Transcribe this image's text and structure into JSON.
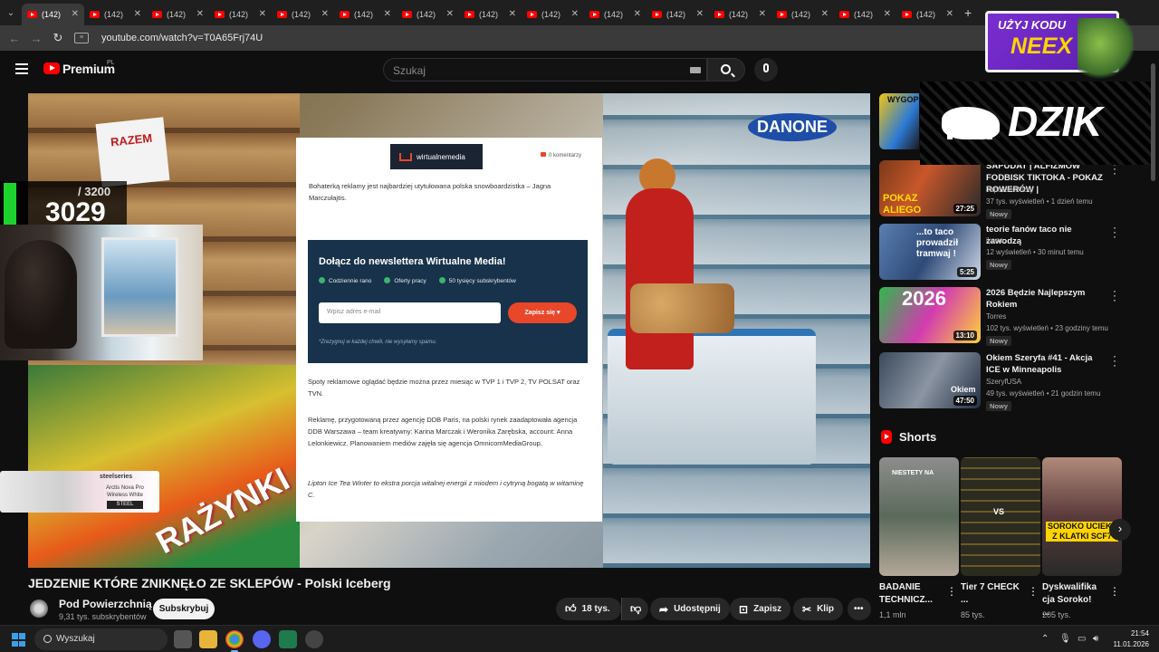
{
  "browser": {
    "tabs": [
      {
        "label": "(142)",
        "active": true
      },
      {
        "label": "(142)",
        "active": false
      },
      {
        "label": "(142)",
        "active": false
      },
      {
        "label": "(142)",
        "active": false
      },
      {
        "label": "(142)",
        "active": false
      },
      {
        "label": "(142)",
        "active": false
      },
      {
        "label": "(142)",
        "active": false
      },
      {
        "label": "(142)",
        "active": false
      },
      {
        "label": "(142)",
        "active": false
      },
      {
        "label": "(142)",
        "active": false
      },
      {
        "label": "(142)",
        "active": false
      },
      {
        "label": "(142)",
        "active": false
      },
      {
        "label": "(142)",
        "active": false
      },
      {
        "label": "(142)",
        "active": false
      },
      {
        "label": "(142)",
        "active": false
      }
    ],
    "url": "youtube.com/watch?v=T0A65Frj74U"
  },
  "youtube": {
    "logo_text": "Premium",
    "logo_region": "PL",
    "search_placeholder": "Szukaj"
  },
  "video": {
    "title": "JEDZENIE KTÓRE ZNIKNĘŁO ZE SKLEPÓW - Polski Iceberg",
    "channel": "Pod Powierzchnią",
    "subscribers": "9,31 tys. subskrybentów",
    "subscribe_label": "Subskrybuj",
    "likes": "18 tys.",
    "share_label": "Udostępnij",
    "save_label": "Zapisz",
    "clip_label": "Klip",
    "scene": {
      "sign_text": "RAZEM",
      "brand_sign": "DANONE",
      "bag_text": "RAŻYNKI"
    }
  },
  "article": {
    "logo": "wirtualnemedia",
    "comments": "0 komentarzy",
    "lead": "Bohaterką reklamy jest najbardziej utytułowana polska snowboardzistka – Jagna Marczułajtis.",
    "newsletter": {
      "title": "Dołącz do newslettera Wirtualne Media!",
      "features": [
        "Codziennie rano",
        "Oferty pracy",
        "50 tysięcy subskrybentów"
      ],
      "email_placeholder": "Wpisz adres e-mail",
      "button": "Zapisz się",
      "note": "*Zrezygnuj w każdej chwili, nie wysyłamy spamu."
    },
    "p1": "Spoty reklamowe oglądać będzie można przez miesiąc w TVP 1 i TVP 2, TV POLSAT oraz TVN.",
    "p2": "Reklamę, przygotowaną przez agencję DDB Paris, na polski rynek zaadaptowała agencja DDB Warszawa – team kreatywny: Karina Marczak i Weronika Zarębska, account: Anna Lelonkiewicz. Planowaniem mediów zajęła się agencja OmnicomMediaGroup.",
    "p3": "Lipton Ice Tea Winter to ekstra porcja witalnej energii z miodem i cytryną bogatą w witaminę C."
  },
  "overlay": {
    "score_total": "/ 3200",
    "score_value": "3029",
    "steelseries_brand": "steelseries",
    "steelseries_product": "Arctis Nova Pro Wireless White",
    "steelseries_btn": "STEEL",
    "neex_line1": "UŻYJ KODU",
    "neex_line2": "NEEX",
    "dzik": "DZIK"
  },
  "sidebar": {
    "recs": [
      {
        "title": "SAPUDAT | ALFIZMOW FODBISK TIKTOKA - POKAZ ROWERÓW |",
        "channel": "Japczan Shoty",
        "meta": "37 tys. wyświetleń • 1 dzień temu",
        "badge": "Nowy",
        "duration": "27:25"
      },
      {
        "title": "teorie fanów taco nie zawodzą",
        "channel": "ikano.",
        "meta": "12 wyświetleń • 30 minut temu",
        "badge": "Nowy",
        "duration": "5:25"
      },
      {
        "title": "2026 Będzie Najlepszym Rokiem",
        "channel": "Torres",
        "meta": "102 tys. wyświetleń • 23 godziny temu",
        "badge": "Nowy",
        "duration": "13:10"
      },
      {
        "title": "Okiem Szeryfa #41 - Akcja ICE w Minneapolis",
        "channel": "SzeryfUSA",
        "meta": "49 tys. wyświetleń • 21 godzin temu",
        "badge": "Nowy",
        "duration": "47:50"
      }
    ],
    "shorts_title": "Shorts",
    "shorts": [
      {
        "title": "BADANIE TECHNICZ...",
        "views": "1,1 mln"
      },
      {
        "title": "Tier 7 CHECK ...",
        "views": "85 tys."
      },
      {
        "title": "Dyskwalifika cja Soroko! ...",
        "views": "205 tys."
      }
    ],
    "short_thumb_texts": [
      "NIESTETY NA",
      "VS",
      "SOROKO UCIEKŁ Z KLATKI SCF7"
    ],
    "rec_thumb_texts": [
      "WYGOPR",
      "POKAZ ALIEGO",
      "...to taco prowadził tramwaj !",
      "2026",
      "Okiem"
    ]
  },
  "taskbar": {
    "search": "Wyszukaj",
    "time": "21:54",
    "date": "11.01.2026"
  }
}
